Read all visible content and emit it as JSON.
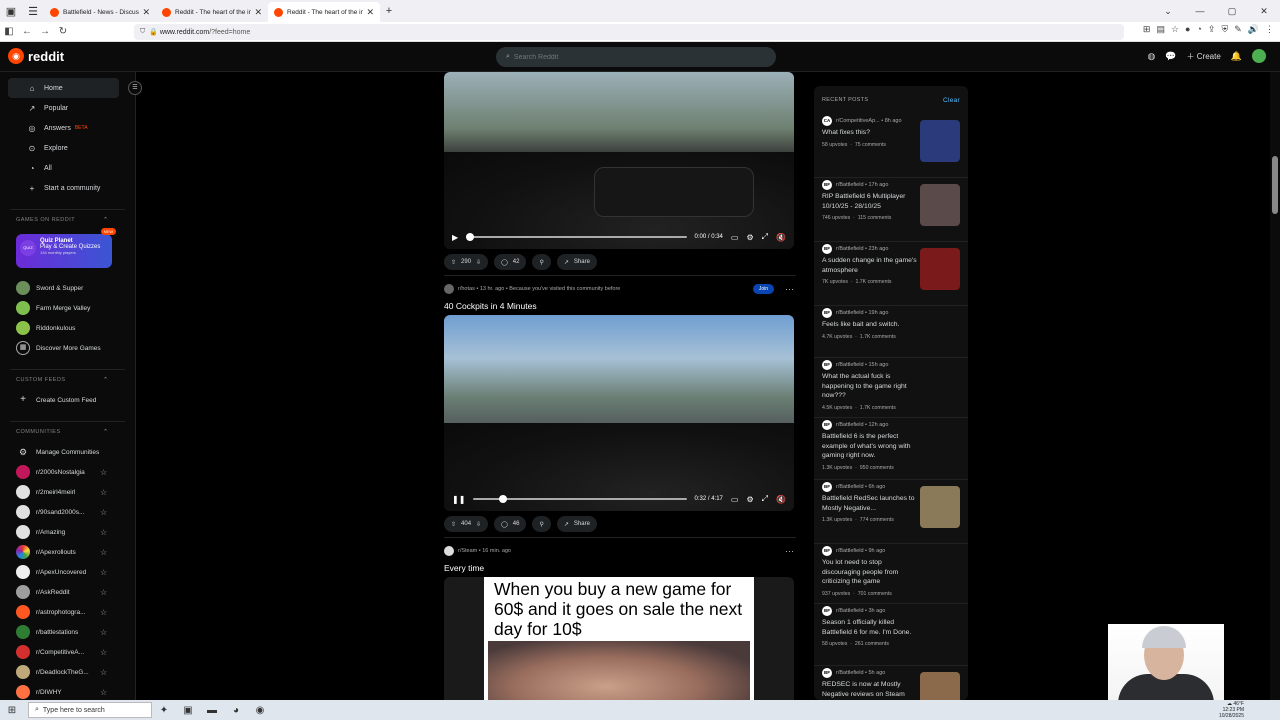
{
  "browser": {
    "tabs": [
      {
        "label": "Battlefield - News - Discussion",
        "active": false
      },
      {
        "label": "Reddit - The heart of the intern",
        "active": false
      },
      {
        "label": "Reddit - The heart of the intern",
        "active": true
      }
    ],
    "url_host": "www.reddit.com",
    "url_path": "/?feed=home"
  },
  "header": {
    "logo": "reddit",
    "search_placeholder": "Search Reddit",
    "create_label": "Create"
  },
  "sidebar": {
    "nav": [
      {
        "label": "Home",
        "icon": "home-icon",
        "active": true
      },
      {
        "label": "Popular",
        "icon": "popular-icon"
      },
      {
        "label": "Answers",
        "icon": "answers-icon",
        "badge": "BETA"
      },
      {
        "label": "Explore",
        "icon": "explore-icon"
      },
      {
        "label": "All",
        "icon": "all-icon"
      },
      {
        "label": "Start a community",
        "icon": "plus-icon"
      }
    ],
    "games_header": "GAMES ON REDDIT",
    "quiz": {
      "title": "Quiz Planet",
      "subtitle": "Play & Create Quizzes",
      "players": "134 monthly players",
      "badge": "NEW"
    },
    "games": [
      {
        "label": "Sword & Supper",
        "color": "#6a8f5a"
      },
      {
        "label": "Farm Merge Valley",
        "color": "#7fbf4f"
      },
      {
        "label": "Riddonkulous",
        "color": "#8bc34a"
      },
      {
        "label": "Discover More Games",
        "color": ""
      }
    ],
    "custom_feeds_header": "CUSTOM FEEDS",
    "create_custom_feed": "Create Custom Feed",
    "communities_header": "COMMUNITIES",
    "manage_communities": "Manage Communities",
    "communities": [
      {
        "label": "r/2000sNostalgia",
        "color": "#c2185b"
      },
      {
        "label": "r/2meirl4meirl",
        "color": "#e0e0e0"
      },
      {
        "label": "r/90sand2000s...",
        "color": "#e0e0e0"
      },
      {
        "label": "r/Amazing",
        "color": "#e0e0e0"
      },
      {
        "label": "r/Apexrollouts",
        "color": "#e53935"
      },
      {
        "label": "r/ApexUncovered",
        "color": "#eeeeee"
      },
      {
        "label": "r/AskReddit",
        "color": "#9e9e9e"
      },
      {
        "label": "r/astrophotogra...",
        "color": "#ff5722"
      },
      {
        "label": "r/battlestations",
        "color": "#2e7d32"
      },
      {
        "label": "r/CompetitiveA...",
        "color": "#d32f2f"
      },
      {
        "label": "r/DeadlockTheG...",
        "color": "#bfa97a"
      },
      {
        "label": "r/DIWHY",
        "color": "#ff7043"
      }
    ]
  },
  "feed": {
    "video1": {
      "time": "0:00 / 0:34",
      "upvotes": "290",
      "comments": "42",
      "share": "Share"
    },
    "post2": {
      "subreddit": "r/hotas",
      "age": "13 hr. ago",
      "reason": "Because you've visited this community before",
      "join": "Join",
      "title": "40 Cockpits in 4 Minutes",
      "time": "0:32 / 4:17",
      "upvotes": "404",
      "comments": "46",
      "share": "Share",
      "progress": 0.12
    },
    "post3": {
      "subreddit": "r/Steam",
      "age": "16 min. ago",
      "title": "Every time",
      "meme_text": "When you buy a new game for 60$ and it goes on sale the next day for 10$"
    }
  },
  "recent": {
    "header": "RECENT POSTS",
    "clear": "Clear",
    "posts": [
      {
        "sub": "r/CompetitiveAp...",
        "age": "8h ago",
        "title": "What fixes this?",
        "upvotes": "58 upvotes",
        "comments": "75 comments",
        "thumb": "#2a3a7a",
        "icon": "CA"
      },
      {
        "sub": "r/Battlefield",
        "age": "17h ago",
        "title": "RIP Battlefield 6 Multiplayer 10/10/25 - 28/10/25",
        "upvotes": "746 upvotes",
        "comments": "115 comments",
        "thumb": "#5a4a4a",
        "icon": "BF"
      },
      {
        "sub": "r/Battlefield",
        "age": "23h ago",
        "title": "A sudden change in the game's atmosphere",
        "upvotes": "7K upvotes",
        "comments": "1.7K comments",
        "thumb": "#7a1a1a",
        "icon": "BF"
      },
      {
        "sub": "r/Battlefield",
        "age": "19h ago",
        "title": "Feels like bait and switch.",
        "upvotes": "4.7K upvotes",
        "comments": "1.7K comments",
        "thumb": "",
        "icon": "BF"
      },
      {
        "sub": "r/Battlefield",
        "age": "15h ago",
        "title": "What the actual fuck is happening to the game right now???",
        "upvotes": "4.5K upvotes",
        "comments": "1.7K comments",
        "thumb": "",
        "icon": "BF"
      },
      {
        "sub": "r/Battlefield",
        "age": "12h ago",
        "title": "Battlefield 6 is the perfect example of what's wrong with gaming right now.",
        "upvotes": "1.3K upvotes",
        "comments": "950 comments",
        "thumb": "",
        "icon": "BF"
      },
      {
        "sub": "r/Battlefield",
        "age": "6h ago",
        "title": "Battlefield RedSec launches to Mostly Negative...",
        "upvotes": "1.3K upvotes",
        "comments": "774 comments",
        "thumb": "#8a7a5a",
        "icon": "BF"
      },
      {
        "sub": "r/Battlefield",
        "age": "9h ago",
        "title": "You lot need to stop discouraging people from criticizing the game",
        "upvotes": "937 upvotes",
        "comments": "701 comments",
        "thumb": "",
        "icon": "BF"
      },
      {
        "sub": "r/Battlefield",
        "age": "3h ago",
        "title": "Season 1 officially killed Battlefield 6 for me. I'm Done.",
        "upvotes": "58 upvotes",
        "comments": "261 comments",
        "thumb": "",
        "icon": "BF"
      },
      {
        "sub": "r/Battlefield",
        "age": "5h ago",
        "title": "REDSEC is now at Mostly Negative reviews on Steam",
        "upvotes": "",
        "comments": "",
        "thumb": "#8a6a4a",
        "icon": "BF"
      }
    ]
  },
  "taskbar": {
    "search_placeholder": "Type here to search",
    "temp": "46°F",
    "time": "12:23 PM",
    "date": "10/28/2025"
  }
}
